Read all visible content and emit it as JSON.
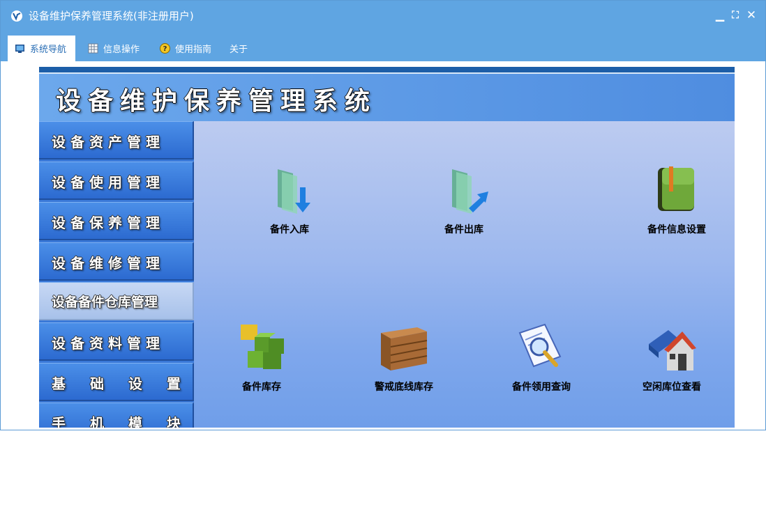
{
  "window": {
    "title": "设备维护保养管理系统(非注册用户)",
    "controls": {
      "minimize": "▁",
      "restore": "⛶",
      "close": "✕"
    }
  },
  "tabs": [
    {
      "label": "系统导航",
      "icon": "monitor-icon",
      "active": true
    },
    {
      "label": "信息操作",
      "icon": "grid-icon",
      "active": false
    },
    {
      "label": "使用指南",
      "icon": "help-icon",
      "active": false
    },
    {
      "label": "关于",
      "icon": "",
      "active": false
    }
  ],
  "app": {
    "title": "设备维护保养管理系统",
    "menu": [
      {
        "label": "设备资产管理",
        "active": false
      },
      {
        "label": "设备使用管理",
        "active": false
      },
      {
        "label": "设备保养管理",
        "active": false
      },
      {
        "label": "设备维修管理",
        "active": false
      },
      {
        "label": "设备备件仓库管理",
        "active": true
      },
      {
        "label": "设备资料管理",
        "active": false
      },
      {
        "label": "基 础 设 置",
        "active": false
      },
      {
        "label": "手 机 模 块",
        "active": false
      }
    ],
    "functions": [
      {
        "label": "备件入库",
        "icon": "folder-in-icon"
      },
      {
        "label": "备件出库",
        "icon": "folder-out-icon"
      },
      {
        "label": "备件信息设置",
        "icon": "green-book-icon"
      },
      {
        "label": "备件库存",
        "icon": "cubes-icon"
      },
      {
        "label": "警戒底线库存",
        "icon": "wooden-crate-icon"
      },
      {
        "label": "备件领用查询",
        "icon": "magnifier-document-icon"
      },
      {
        "label": "空闲库位查看",
        "icon": "house-icon"
      }
    ]
  },
  "colors": {
    "titlebar": "#5fa5e2",
    "sidebar": "#3a79d8",
    "panel_top": "#bccbf0",
    "panel_bottom": "#6f9ee9"
  }
}
